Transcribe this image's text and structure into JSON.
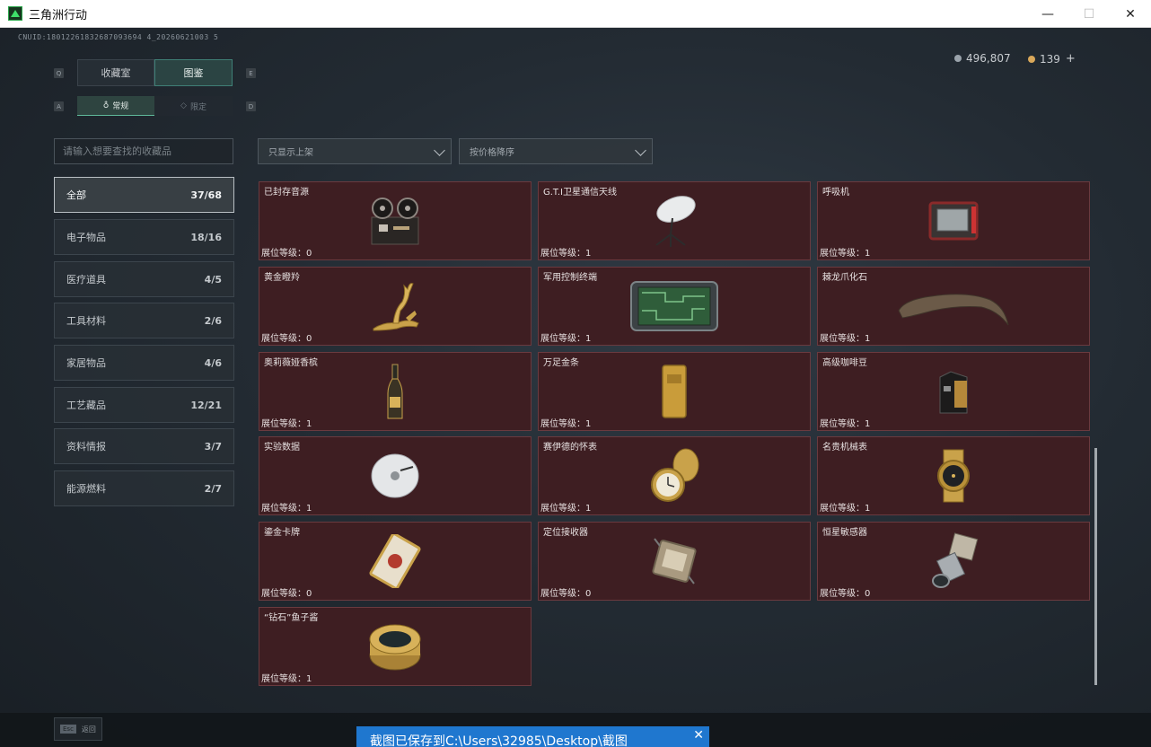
{
  "window": {
    "title": "三角洲行动",
    "minimize": "—",
    "maximize": "☐",
    "close": "✕"
  },
  "uid": "CNUID:18012261832687093694 4_20260621003 5",
  "currency": {
    "primary": "496,807",
    "secondary": "139",
    "plus": "+"
  },
  "key_hints": {
    "q": "Q",
    "e": "E",
    "a": "A",
    "d": "D"
  },
  "tabs": [
    {
      "label": "收藏室"
    },
    {
      "label": "图鉴"
    }
  ],
  "subtabs": [
    {
      "label": "常规"
    },
    {
      "label": "限定"
    }
  ],
  "search": {
    "placeholder": "请输入想要查找的收藏品"
  },
  "filters": {
    "availability": "只显示上架",
    "sort": "按价格降序"
  },
  "categories": [
    {
      "label": "全部",
      "count": "37/68"
    },
    {
      "label": "电子物品",
      "count": "18/16"
    },
    {
      "label": "医疗道具",
      "count": "4/5"
    },
    {
      "label": "工具材料",
      "count": "2/6"
    },
    {
      "label": "家居物品",
      "count": "4/6"
    },
    {
      "label": "工艺藏品",
      "count": "12/21"
    },
    {
      "label": "资料情报",
      "count": "3/7"
    },
    {
      "label": "能源燃料",
      "count": "2/7"
    }
  ],
  "items": [
    {
      "name": "已封存音源",
      "level": "展位等级：0",
      "icon": "reel-recorder-icon"
    },
    {
      "name": "G.T.I卫星通信天线",
      "level": "展位等级：1",
      "icon": "satellite-dish-icon"
    },
    {
      "name": "呼吸机",
      "level": "展位等级：1",
      "icon": "ventilator-icon"
    },
    {
      "name": "黄金瞪羚",
      "level": "展位等级：0",
      "icon": "golden-gazelle-icon"
    },
    {
      "name": "军用控制终端",
      "level": "展位等级：1",
      "icon": "control-terminal-icon"
    },
    {
      "name": "棘龙爪化石",
      "level": "展位等级：1",
      "icon": "claw-fossil-icon"
    },
    {
      "name": "奥莉薇娅香槟",
      "level": "展位等级：1",
      "icon": "champagne-icon"
    },
    {
      "name": "万足金条",
      "level": "展位等级：1",
      "icon": "gold-bar-icon"
    },
    {
      "name": "高级咖啡豆",
      "level": "展位等级：1",
      "icon": "coffee-bag-icon"
    },
    {
      "name": "实验数据",
      "level": "展位等级：1",
      "icon": "disc-icon"
    },
    {
      "name": "赛伊德的怀表",
      "level": "展位等级：1",
      "icon": "pocket-watch-icon"
    },
    {
      "name": "名贵机械表",
      "level": "展位等级：1",
      "icon": "wristwatch-icon"
    },
    {
      "name": "鎏金卡牌",
      "level": "展位等级：0",
      "icon": "gilded-card-icon"
    },
    {
      "name": "定位接收器",
      "level": "展位等级：0",
      "icon": "gps-receiver-icon"
    },
    {
      "name": "恒星敏感器",
      "level": "展位等级：0",
      "icon": "star-sensor-icon"
    },
    {
      "name": "“钻石”鱼子酱",
      "level": "展位等级：1",
      "icon": "caviar-tin-icon"
    }
  ],
  "bottom": {
    "esc_key": "Esc",
    "esc_label": "返回"
  },
  "toast": {
    "text": "截图已保存到C:\\Users\\32985\\Desktop\\截图",
    "close": "✕"
  },
  "colors": {
    "card_bg": "#3e1e22",
    "card_border": "#6a3a3f",
    "accent": "#3f7f76",
    "toast": "#1f77cf"
  }
}
